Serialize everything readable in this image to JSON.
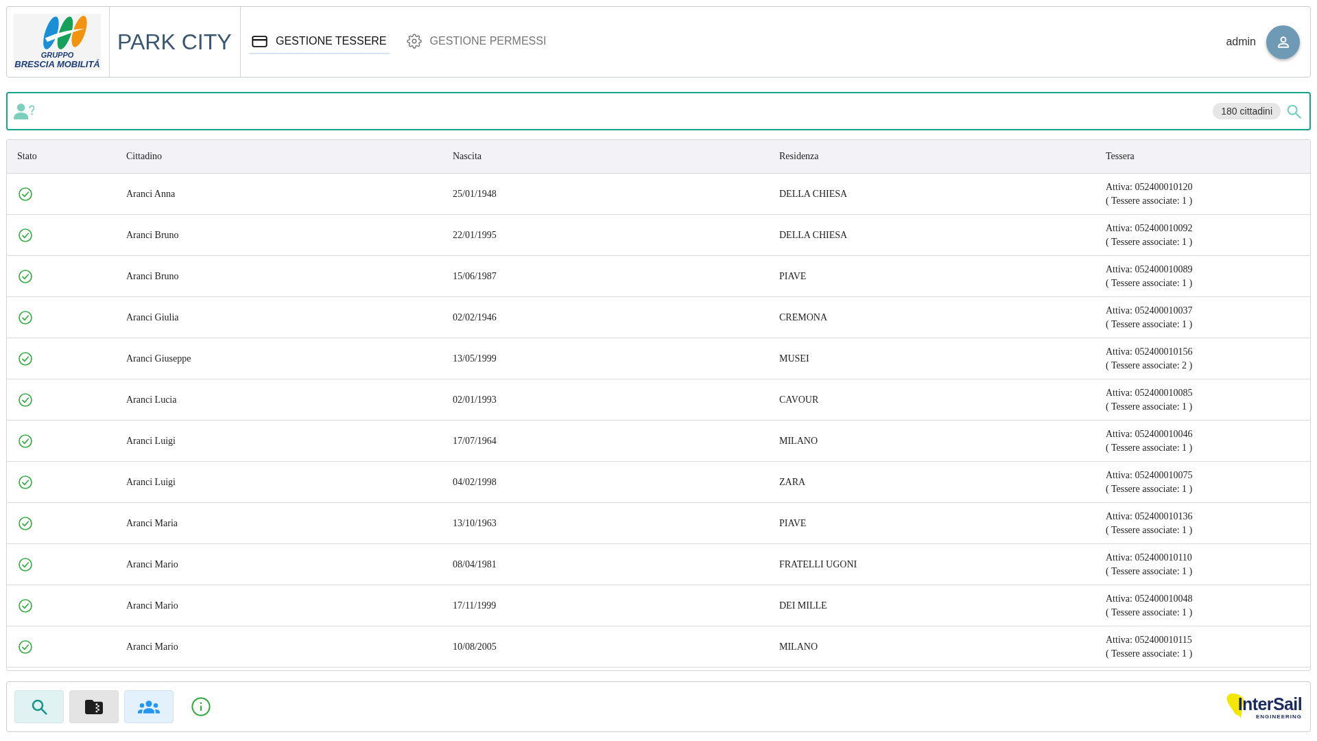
{
  "header": {
    "logo": {
      "line_1": "GRUPPO",
      "line_2": "BRESCIA MOBILITÁ"
    },
    "app_title": "PARK CITY",
    "tabs": [
      {
        "kind": "card",
        "label": "GESTIONE TESSERE",
        "selected": true
      },
      {
        "kind": "gear",
        "label": "GESTIONE PERMESSI",
        "selected": false
      }
    ],
    "user": {
      "name": "admin"
    }
  },
  "search": {
    "count_badge": "180 cittadini"
  },
  "table": {
    "columns": [
      "Stato",
      "Cittadino",
      "Nascita",
      "Residenza",
      "Tessera"
    ],
    "rows": [
      {
        "active": true,
        "name": "Aranci Anna",
        "birth": "25/01/1948",
        "residence": "DELLA CHIESA",
        "card": "Attiva: 052400010120",
        "linked": "( Tessere associate: 1 )"
      },
      {
        "active": true,
        "name": "Aranci Bruno",
        "birth": "22/01/1995",
        "residence": "DELLA CHIESA",
        "card": "Attiva: 052400010092",
        "linked": "( Tessere associate: 1 )"
      },
      {
        "active": true,
        "name": "Aranci Bruno",
        "birth": "15/06/1987",
        "residence": "PIAVE",
        "card": "Attiva: 052400010089",
        "linked": "( Tessere associate: 1 )"
      },
      {
        "active": true,
        "name": "Aranci Giulia",
        "birth": "02/02/1946",
        "residence": "CREMONA",
        "card": "Attiva: 052400010037",
        "linked": "( Tessere associate: 1 )"
      },
      {
        "active": true,
        "name": "Aranci Giuseppe",
        "birth": "13/05/1999",
        "residence": "MUSEI",
        "card": "Attiva: 052400010156",
        "linked": "( Tessere associate: 2 )"
      },
      {
        "active": true,
        "name": "Aranci Lucia",
        "birth": "02/01/1993",
        "residence": "CAVOUR",
        "card": "Attiva: 052400010085",
        "linked": "( Tessere associate: 1 )"
      },
      {
        "active": true,
        "name": "Aranci Luigi",
        "birth": "17/07/1964",
        "residence": "MILANO",
        "card": "Attiva: 052400010046",
        "linked": "( Tessere associate: 1 )"
      },
      {
        "active": true,
        "name": "Aranci Luigi",
        "birth": "04/02/1998",
        "residence": "ZARA",
        "card": "Attiva: 052400010075",
        "linked": "( Tessere associate: 1 )"
      },
      {
        "active": true,
        "name": "Aranci Maria",
        "birth": "13/10/1963",
        "residence": "PIAVE",
        "card": "Attiva: 052400010136",
        "linked": "( Tessere associate: 1 )"
      },
      {
        "active": true,
        "name": "Aranci Mario",
        "birth": "08/04/1981",
        "residence": "FRATELLI UGONI",
        "card": "Attiva: 052400010110",
        "linked": "( Tessere associate: 1 )"
      },
      {
        "active": true,
        "name": "Aranci Mario",
        "birth": "17/11/1999",
        "residence": "DEI MILLE",
        "card": "Attiva: 052400010048",
        "linked": "( Tessere associate: 1 )"
      },
      {
        "active": true,
        "name": "Aranci Mario",
        "birth": "10/08/2005",
        "residence": "MILANO",
        "card": "Attiva: 052400010115",
        "linked": "( Tessere associate: 1 )"
      }
    ]
  },
  "toolbar": {
    "buttons": [
      {
        "kind": "search"
      },
      {
        "kind": "archive"
      },
      {
        "kind": "people"
      },
      {
        "kind": "info"
      }
    ]
  },
  "partner_logo": {
    "name": "InterSail",
    "tagline": "ENGINEERING"
  }
}
